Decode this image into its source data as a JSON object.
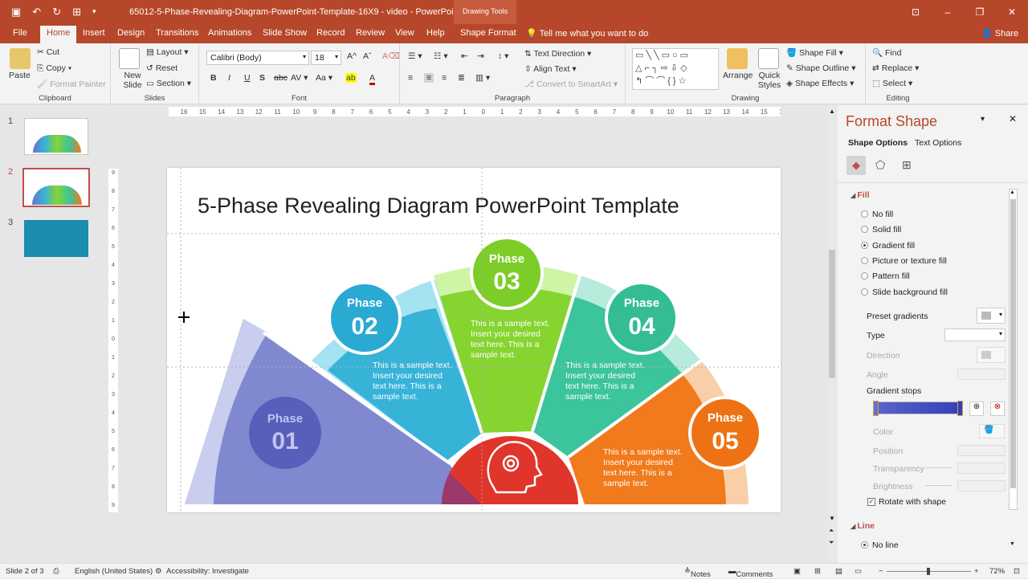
{
  "titlebar": {
    "document_title": "65012-5-Phase-Revealing-Diagram-PowerPoint-Template-16X9 - video - PowerPoint",
    "contextual": "Drawing Tools",
    "minimize": "–",
    "restore": "❐",
    "close": "✕",
    "ribbon_display": "⊡"
  },
  "tabs": [
    "File",
    "Home",
    "Insert",
    "Design",
    "Transitions",
    "Animations",
    "Slide Show",
    "Record",
    "Review",
    "View",
    "Help",
    "Shape Format"
  ],
  "tell_me": "Tell me what you want to do",
  "share": "Share",
  "ribbon": {
    "clipboard": {
      "label": "Clipboard",
      "paste": "Paste",
      "cut": "Cut",
      "copy": "Copy",
      "format_painter": "Format Painter"
    },
    "slides": {
      "label": "Slides",
      "new_slide": "New Slide",
      "layout": "Layout",
      "reset": "Reset",
      "section": "Section"
    },
    "font": {
      "label": "Font",
      "font_name": "Calibri (Body)",
      "font_size": "18"
    },
    "paragraph": {
      "label": "Paragraph",
      "text_direction": "Text Direction",
      "align_text": "Align Text",
      "convert_smartart": "Convert to SmartArt"
    },
    "drawing": {
      "label": "Drawing",
      "arrange": "Arrange",
      "quick_styles": "Quick Styles",
      "shape_fill": "Shape Fill",
      "shape_outline": "Shape Outline",
      "shape_effects": "Shape Effects"
    },
    "editing": {
      "label": "Editing",
      "find": "Find",
      "replace": "Replace",
      "select": "Select"
    }
  },
  "thumbnails": [
    {
      "num": "1"
    },
    {
      "num": "2"
    },
    {
      "num": "3"
    }
  ],
  "slide": {
    "title": "5-Phase Revealing Diagram PowerPoint Template",
    "phase_word": "Phase",
    "phases": [
      {
        "num": "01",
        "color": "#6a74c8"
      },
      {
        "num": "02",
        "color": "#37b3d8",
        "text": [
          "This is a sample text.",
          "Insert your desired",
          "text here. This is a",
          "sample text."
        ]
      },
      {
        "num": "03",
        "color": "#86d430",
        "text": [
          "This is a sample text.",
          "Insert your desired",
          "text here. This is a",
          "sample text."
        ]
      },
      {
        "num": "04",
        "color": "#3cc49c",
        "text": [
          "This is a sample text.",
          "Insert your desired",
          "text here. This is a",
          "sample text."
        ]
      },
      {
        "num": "05",
        "color": "#f07a1c",
        "text": [
          "This is a sample text.",
          "Insert your desired",
          "text here. This is a",
          "sample text."
        ]
      }
    ],
    "center_color": "#e0352b"
  },
  "format_pane": {
    "title": "Format Shape",
    "tab_shape": "Shape Options",
    "tab_text": "Text Options",
    "fill_section": "Fill",
    "fill_options": [
      "No fill",
      "Solid fill",
      "Gradient fill",
      "Picture or texture fill",
      "Pattern fill",
      "Slide background fill"
    ],
    "preset_gradients": "Preset gradients",
    "type": "Type",
    "direction": "Direction",
    "angle": "Angle",
    "gradient_stops": "Gradient stops",
    "color": "Color",
    "position": "Position",
    "transparency": "Transparency",
    "brightness": "Brightness",
    "rotate": "Rotate with shape",
    "line_section": "Line",
    "no_line": "No line"
  },
  "status": {
    "slide": "Slide 2 of 3",
    "language": "English (United States)",
    "accessibility": "Accessibility: Investigate",
    "notes": "Notes",
    "comments": "Comments",
    "zoom": "72%"
  }
}
